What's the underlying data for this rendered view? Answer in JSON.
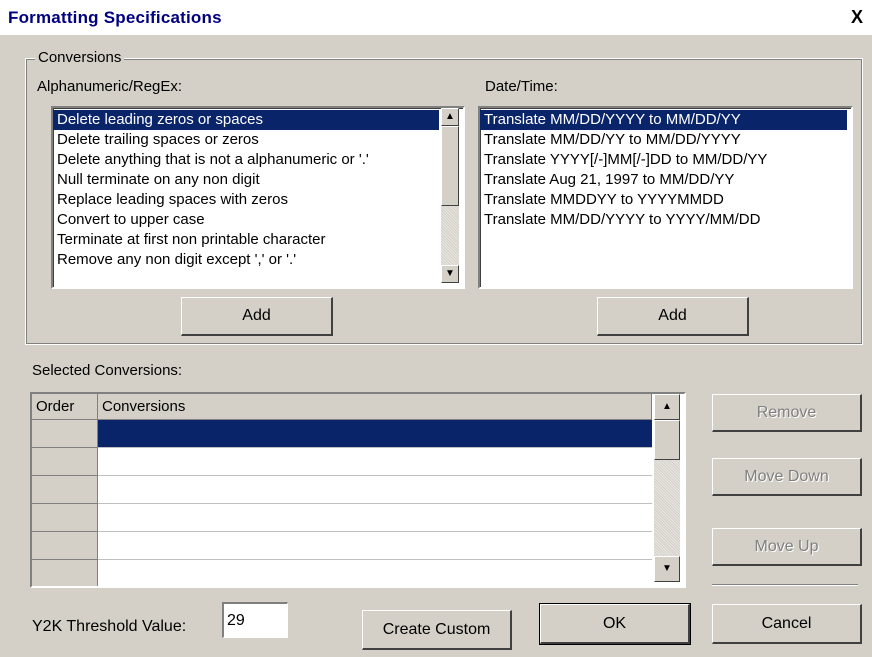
{
  "window": {
    "title": "Formatting Specifications",
    "close_glyph": "X"
  },
  "conversions_group": {
    "legend": "Conversions"
  },
  "alpha": {
    "label": "Alphanumeric/RegEx:",
    "items": [
      "Delete leading zeros or spaces",
      "Delete trailing spaces or zeros",
      "Delete anything that is not a alphanumeric or '.'",
      "Null terminate on any non digit",
      "Replace leading spaces with zeros",
      "Convert to upper case",
      "Terminate at first non printable character",
      "Remove any non digit except ',' or '.'"
    ],
    "selected_index": 0,
    "add_label": "Add"
  },
  "datetime": {
    "label": "Date/Time:",
    "items": [
      "Translate MM/DD/YYYY to MM/DD/YY",
      "Translate MM/DD/YY to MM/DD/YYYY",
      "Translate YYYY[/-]MM[/-]DD to MM/DD/YY",
      "Translate Aug 21, 1997 to MM/DD/YY",
      "Translate MMDDYY to YYYYMMDD",
      "Translate MM/DD/YYYY to YYYY/MM/DD"
    ],
    "selected_index": 0,
    "add_label": "Add"
  },
  "selected": {
    "label": "Selected Conversions:",
    "columns": [
      "Order",
      "Conversions"
    ],
    "row_count": 6
  },
  "side_buttons": {
    "remove": "Remove",
    "move_down": "Move Down",
    "move_up": "Move Up"
  },
  "footer": {
    "y2k_label": "Y2K Threshold Value:",
    "y2k_value": "29",
    "create_custom": "Create Custom",
    "ok": "OK",
    "cancel": "Cancel"
  },
  "colors": {
    "face": "#d4d0c8",
    "selection": "#0a246a",
    "title_text": "#000080"
  }
}
